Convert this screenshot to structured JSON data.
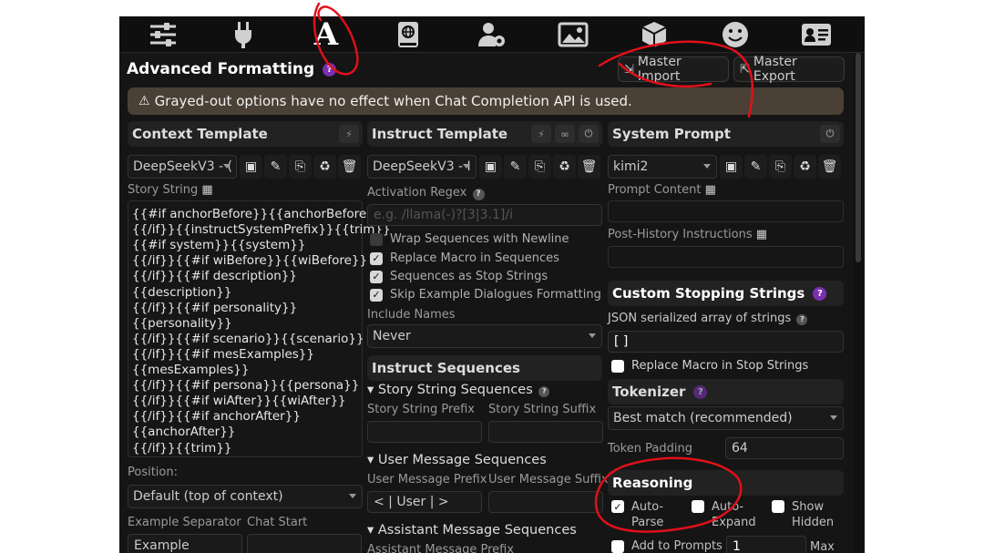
{
  "topbar": {
    "icons": [
      "sliders-icon",
      "plug-icon",
      "text-format-icon",
      "book-globe-icon",
      "user-gear-icon",
      "image-icon",
      "cube-icon",
      "smiley-icon",
      "id-card-icon"
    ],
    "active_letter": "A"
  },
  "header": {
    "title": "Advanced Formatting",
    "help": "?",
    "master_import": "Master Import",
    "master_export": "Master Export"
  },
  "warning": {
    "text": "Grayed-out options have no effect when Chat Completion API is used."
  },
  "context": {
    "title": "Context Template",
    "preset": "DeepSeekV3 - (",
    "story_label": "Story String",
    "story_lines": [
      "{{#if anchorBefore}}{{anchorBefore}}",
      "{{/if}}{{instructSystemPrefix}}{{trim}}",
      "{{#if system}}{{system}}",
      "{{/if}}{{#if wiBefore}}{{wiBefore}}",
      "{{/if}}{{#if description}}",
      "{{description}}",
      "{{/if}}{{#if personality}}",
      "{{personality}}",
      "{{/if}}{{#if scenario}}{{scenario}}",
      "{{/if}}{{#if mesExamples}}",
      "{{mesExamples}}",
      "{{/if}}{{#if persona}}{{persona}}",
      "{{/if}}{{#if wiAfter}}{{wiAfter}}",
      "{{/if}}{{#if anchorAfter}}",
      "{{anchorAfter}}",
      "{{/if}}{{trim}}"
    ],
    "position_label": "Position:",
    "position_value": "Default (top of context)",
    "separator_label": "Example Separator",
    "chat_start_label": "Chat Start",
    "separator_value": "Example"
  },
  "instruct": {
    "title": "Instruct Template",
    "preset": "DeepSeekV3 - I",
    "activation_label": "Activation Regex",
    "activation_placeholder": "e.g. /llama(-)?[3|3.1]/i",
    "checks": [
      {
        "label": "Wrap Sequences with Newline",
        "checked": false
      },
      {
        "label": "Replace Macro in Sequences",
        "checked": true
      },
      {
        "label": "Sequences as Stop Strings",
        "checked": true
      },
      {
        "label": "Skip Example Dialogues Formatting",
        "checked": true
      }
    ],
    "include_names_label": "Include Names",
    "include_names_value": "Never",
    "sequences_title": "Instruct Sequences",
    "story_seq_title": "Story String Sequences",
    "story_prefix": "Story String Prefix",
    "story_suffix": "Story String Suffix",
    "user_seq_title": "User Message Sequences",
    "user_prefix": "User Message Prefix",
    "user_suffix": "User Message Suffix",
    "user_prefix_value": "< | User | >",
    "assistant_seq_title": "Assistant Message Sequences",
    "assistant_prefix": "Assistant Message Prefix"
  },
  "system": {
    "title": "System Prompt",
    "preset": "kimi2",
    "prompt_content_label": "Prompt Content",
    "post_history_label": "Post-History Instructions",
    "stop_title": "Custom Stopping Strings",
    "json_label": "JSON serialized array of strings",
    "json_value": "[ ]",
    "replace_macro": "Replace Macro in Stop Strings",
    "tokenizer_title": "Tokenizer",
    "tokenizer_value": "Best match (recommended)",
    "token_padding_label": "Token Padding",
    "token_padding_value": "64",
    "reasoning_title": "Reasoning",
    "auto_parse": "Auto-\nParse",
    "auto_expand": "Auto-\nExpand",
    "show_hidden": "Show\nHidden",
    "add_prompts": "Add to Prompts",
    "add_value": "1",
    "max": "Max"
  },
  "colors": {
    "accent": "#7a2fb0",
    "annotation": "#e0101a",
    "warning_bg": "#4a4035"
  }
}
